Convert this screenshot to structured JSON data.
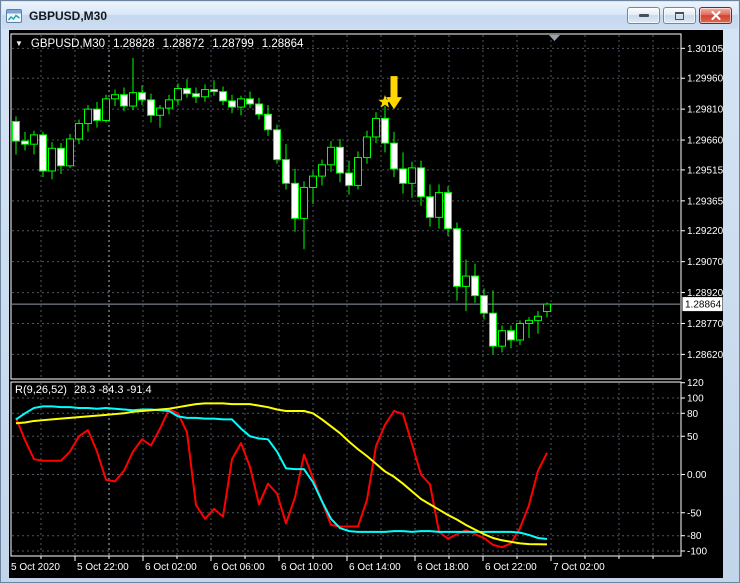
{
  "window": {
    "title": "GBPUSD,M30",
    "controls": {
      "minimize": "minimize",
      "restore": "restore",
      "close": "close"
    }
  },
  "icons": {
    "title_icon": "chart-window-icon",
    "legend_icon": "dropdown-triangle-icon",
    "shift_marker": "chart-shift-triangle-icon"
  },
  "chart": {
    "legend": {
      "symbol": "GBPUSD,M30",
      "open": "1.28828",
      "high": "1.28872",
      "low": "1.28799",
      "close": "1.28864"
    },
    "indicator": {
      "label": "R(9,26,52)",
      "values_text": "28.3 -84.3 -91.4"
    },
    "price_axis": {
      "ticks": [
        "1.30105",
        "1.29960",
        "1.29810",
        "1.29660",
        "1.29515",
        "1.29365",
        "1.29220",
        "1.29070",
        "1.28920",
        "1.28770",
        "1.28620"
      ],
      "current": "1.28864"
    },
    "indicator_axis": {
      "ticks": [
        "120",
        "100",
        "80",
        "50",
        "0.00",
        "-50",
        "-80",
        "-100"
      ]
    },
    "time_axis": {
      "labels": [
        "5 Oct 2020",
        "5 Oct 22:00",
        "6 Oct 02:00",
        "6 Oct 06:00",
        "6 Oct 10:00",
        "6 Oct 14:00",
        "6 Oct 18:00",
        "6 Oct 22:00",
        "7 Oct 02:00"
      ]
    }
  },
  "colors": {
    "background": "#000000",
    "foreground": "#ffffff",
    "grid": "#4f5962",
    "day_separator": "#aeb9c4",
    "bar_outline": "#00ff00",
    "bull_fill": "#000000",
    "bear_fill": "#ffffff",
    "bid_line": "#939da9",
    "price_tag_bg": "#ffffff",
    "price_tag_text": "#000000",
    "indicator_red": "#ff0000",
    "indicator_cyan": "#00ffff",
    "indicator_yellow": "#ffff00",
    "annotation_yellow": "#ffd800",
    "shift_marker": "#9aa3ad"
  },
  "chart_data": {
    "type": "candlestick",
    "symbol": "GBPUSD",
    "period": "M30",
    "current_price": 1.28864,
    "price_ticks": [
      1.30105,
      1.2996,
      1.2981,
      1.2966,
      1.29515,
      1.29365,
      1.2922,
      1.2907,
      1.2892,
      1.2877,
      1.2862
    ],
    "candles": [
      [
        1.2975,
        1.29775,
        1.2959,
        1.29655
      ],
      [
        1.29655,
        1.297,
        1.2961,
        1.2964
      ],
      [
        1.2964,
        1.29705,
        1.2959,
        1.29685
      ],
      [
        1.29685,
        1.297,
        1.2948,
        1.2951
      ],
      [
        1.2951,
        1.2965,
        1.2947,
        1.2962
      ],
      [
        1.2962,
        1.29645,
        1.29495,
        1.29535
      ],
      [
        1.29535,
        1.2969,
        1.29525,
        1.29665
      ],
      [
        1.29665,
        1.2976,
        1.2964,
        1.2974
      ],
      [
        1.2974,
        1.2983,
        1.297,
        1.2981
      ],
      [
        1.2981,
        1.29845,
        1.2972,
        1.29755
      ],
      [
        1.29755,
        1.2988,
        1.29745,
        1.2986
      ],
      [
        1.2986,
        1.29905,
        1.29825,
        1.2988
      ],
      [
        1.2988,
        1.29915,
        1.298,
        1.29825
      ],
      [
        1.29825,
        1.30058,
        1.29805,
        1.2989
      ],
      [
        1.2989,
        1.29925,
        1.2983,
        1.29855
      ],
      [
        1.29855,
        1.29885,
        1.29745,
        1.2978
      ],
      [
        1.2978,
        1.2983,
        1.2972,
        1.29815
      ],
      [
        1.29815,
        1.2988,
        1.29785,
        1.29855
      ],
      [
        1.29855,
        1.29935,
        1.2983,
        1.2991
      ],
      [
        1.2991,
        1.29955,
        1.29865,
        1.29885
      ],
      [
        1.29885,
        1.29915,
        1.2984,
        1.2987
      ],
      [
        1.2987,
        1.2993,
        1.29845,
        1.29905
      ],
      [
        1.29905,
        1.2995,
        1.29875,
        1.29895
      ],
      [
        1.29895,
        1.2992,
        1.2983,
        1.2985
      ],
      [
        1.2985,
        1.2988,
        1.2979,
        1.2982
      ],
      [
        1.2982,
        1.29875,
        1.2978,
        1.2986
      ],
      [
        1.2986,
        1.29895,
        1.29815,
        1.29835
      ],
      [
        1.29835,
        1.29865,
        1.2976,
        1.29785
      ],
      [
        1.29785,
        1.2983,
        1.2968,
        1.2971
      ],
      [
        1.2971,
        1.29735,
        1.29545,
        1.29565
      ],
      [
        1.29565,
        1.2964,
        1.2942,
        1.2945
      ],
      [
        1.2945,
        1.2952,
        1.29215,
        1.2928
      ],
      [
        1.2928,
        1.2946,
        1.2913,
        1.2943
      ],
      [
        1.2943,
        1.2951,
        1.2935,
        1.29485
      ],
      [
        1.29485,
        1.29565,
        1.2944,
        1.2954
      ],
      [
        1.2954,
        1.29655,
        1.29505,
        1.29625
      ],
      [
        1.29625,
        1.29665,
        1.29455,
        1.295
      ],
      [
        1.295,
        1.2956,
        1.29395,
        1.2944
      ],
      [
        1.2944,
        1.29605,
        1.2942,
        1.29575
      ],
      [
        1.29575,
        1.29705,
        1.29545,
        1.29675
      ],
      [
        1.29675,
        1.29795,
        1.29645,
        1.29765
      ],
      [
        1.29765,
        1.29825,
        1.296,
        1.29645
      ],
      [
        1.29645,
        1.297,
        1.2948,
        1.2952
      ],
      [
        1.2952,
        1.296,
        1.294,
        1.2945
      ],
      [
        1.2945,
        1.29555,
        1.2938,
        1.29525
      ],
      [
        1.29525,
        1.2956,
        1.2934,
        1.29385
      ],
      [
        1.29385,
        1.29445,
        1.2924,
        1.29285
      ],
      [
        1.29285,
        1.29445,
        1.2923,
        1.29405
      ],
      [
        1.29405,
        1.29435,
        1.29195,
        1.2923
      ],
      [
        1.2923,
        1.2926,
        1.2888,
        1.2895
      ],
      [
        1.2895,
        1.2908,
        1.2883,
        1.29
      ],
      [
        1.29,
        1.2906,
        1.2887,
        1.28905
      ],
      [
        1.28905,
        1.2894,
        1.2879,
        1.2882
      ],
      [
        1.2882,
        1.2893,
        1.2862,
        1.2866
      ],
      [
        1.2866,
        1.2876,
        1.2863,
        1.28735
      ],
      [
        1.28735,
        1.2876,
        1.2865,
        1.2869
      ],
      [
        1.2869,
        1.28785,
        1.28665,
        1.2877
      ],
      [
        1.2877,
        1.288,
        1.287,
        1.28785
      ],
      [
        1.28785,
        1.2883,
        1.2872,
        1.28805
      ],
      [
        1.28828,
        1.28872,
        1.28799,
        1.28864
      ]
    ],
    "annotations": [
      {
        "type": "arrow-down",
        "name": "sell-signal-arrow",
        "bar_index": 42,
        "price": 1.2981,
        "color": "#ffd800"
      },
      {
        "type": "star",
        "name": "signal-star",
        "bar_index": 41,
        "price": 1.29845,
        "color": "#ffd800"
      }
    ],
    "indicator": {
      "name": "R(9,26,52)",
      "display_values": [
        28.3,
        -84.3,
        -91.4
      ],
      "axis_ticks": [
        120,
        100,
        80,
        50,
        0,
        -50,
        -80,
        -100
      ],
      "grid_levels": [
        100,
        80,
        50,
        0,
        -50,
        -80,
        -100
      ],
      "series": [
        {
          "name": "line-red",
          "color": "#ff0000",
          "values": [
            74,
            45,
            20,
            18,
            18,
            18,
            30,
            50,
            58,
            30,
            -7,
            -9,
            5,
            30,
            46,
            38,
            60,
            85,
            80,
            55,
            -40,
            -58,
            -45,
            -55,
            20,
            41,
            10,
            -39,
            -12,
            -25,
            -64,
            -30,
            26,
            -5,
            -35,
            -66,
            -68,
            -68,
            -68,
            -33,
            37,
            65,
            83,
            79,
            40,
            0,
            -13,
            -75,
            -84,
            -78,
            -73,
            -78,
            -83,
            -92,
            -95,
            -90,
            -70,
            -40,
            5,
            28.3
          ]
        },
        {
          "name": "line-cyan",
          "color": "#00ffff",
          "values": [
            72,
            80,
            87,
            89,
            89,
            88,
            88,
            87,
            87,
            86,
            87,
            86,
            85,
            84,
            85,
            85,
            84,
            83,
            76,
            74,
            74,
            73,
            73,
            72,
            72,
            60,
            50,
            47,
            46,
            30,
            8,
            7,
            7,
            -10,
            -35,
            -58,
            -70,
            -74,
            -75,
            -75,
            -75,
            -75,
            -74,
            -74,
            -75,
            -74,
            -74,
            -75,
            -75,
            -75,
            -75,
            -75,
            -75,
            -75,
            -75,
            -75,
            -76,
            -79,
            -83,
            -84.3
          ]
        },
        {
          "name": "line-yellow",
          "color": "#ffff00",
          "values": [
            67,
            68,
            70,
            71,
            72,
            73,
            74,
            75,
            76,
            77,
            78,
            79,
            80,
            82,
            83,
            84,
            85,
            86,
            88,
            90,
            92,
            93,
            93,
            93,
            92,
            92,
            92,
            90,
            88,
            85,
            83,
            83,
            83,
            80,
            72,
            63,
            54,
            43,
            33,
            24,
            14,
            4,
            -3,
            -12,
            -22,
            -32,
            -39,
            -46,
            -53,
            -59,
            -66,
            -72,
            -78,
            -83,
            -86,
            -88,
            -90,
            -91,
            -91.2,
            -91.4
          ]
        }
      ]
    }
  }
}
